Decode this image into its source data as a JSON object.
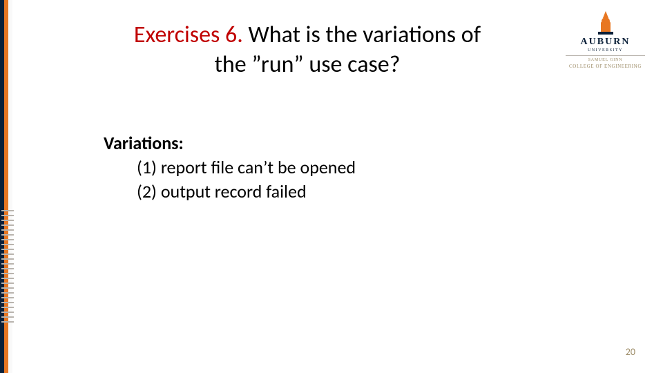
{
  "heading": {
    "prefix": "Exercises 6.",
    "rest_line1": " What is the variations of",
    "line2": "the ”run” use case?"
  },
  "body": {
    "label": "Variations:",
    "items": [
      "(1) report file can’t be opened",
      "(2) output record failed"
    ]
  },
  "logo": {
    "word": "AUBURN",
    "sub": "UNIVERSITY",
    "college_prefix": "SAMUEL GINN",
    "college_name": "COLLEGE OF ENGINEERING"
  },
  "page_number": "20",
  "colors": {
    "accent_red": "#c00000",
    "brand_orange": "#e87722",
    "brand_navy": "#0a2039"
  }
}
